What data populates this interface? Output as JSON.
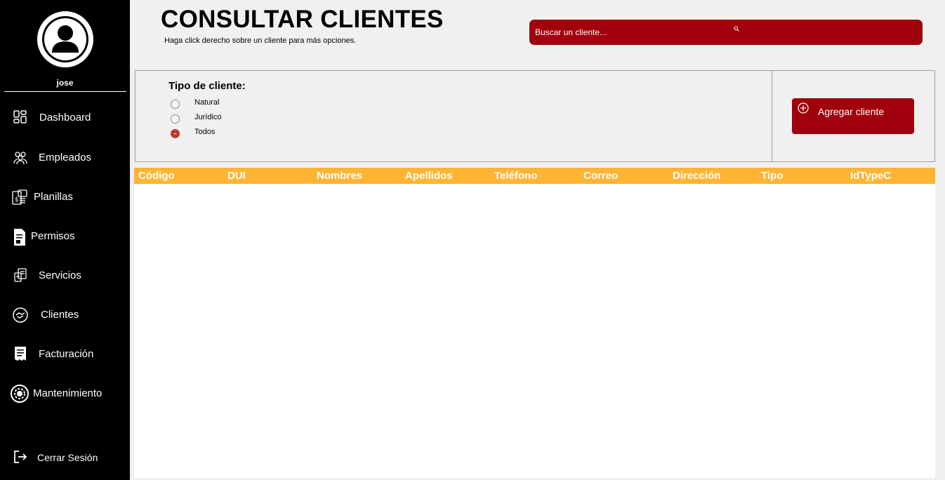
{
  "sidebar": {
    "username": "jose",
    "items": [
      {
        "label": "Dashboard",
        "icon": "dashboard-icon"
      },
      {
        "label": "Empleados",
        "icon": "employees-icon"
      },
      {
        "label": "Planillas",
        "icon": "payroll-icon"
      },
      {
        "label": "Permisos",
        "icon": "permissions-icon"
      },
      {
        "label": "Servicios",
        "icon": "services-icon"
      },
      {
        "label": "Clientes",
        "icon": "handshake-icon"
      },
      {
        "label": "Facturación",
        "icon": "invoice-icon"
      },
      {
        "label": "Mantenimiento",
        "icon": "maintenance-gear-icon"
      }
    ],
    "logout_label": "Cerrar Sesión"
  },
  "header": {
    "title": "CONSULTAR CLIENTES",
    "subtitle": "Haga click derecho sobre un cliente para más opciones."
  },
  "search": {
    "placeholder": "Buscar un cliente..."
  },
  "filter": {
    "title": "Tipo de cliente:",
    "options": [
      {
        "label": "Natural",
        "selected": false
      },
      {
        "label": "Jurídico",
        "selected": false
      },
      {
        "label": "Todos",
        "selected": true
      }
    ]
  },
  "actions": {
    "add_label": "Agregar cliente"
  },
  "table": {
    "columns": [
      "Código",
      "DUI",
      "Nombres",
      "Apellidos",
      "Teléfono",
      "Correo",
      "Dirección",
      "Tipo",
      "IdTypeC"
    ],
    "rows": []
  },
  "colors": {
    "sidebar_bg": "#000000",
    "accent_red": "#a0000b",
    "header_orange": "#ffb433",
    "radio_selected": "#c0392b"
  }
}
